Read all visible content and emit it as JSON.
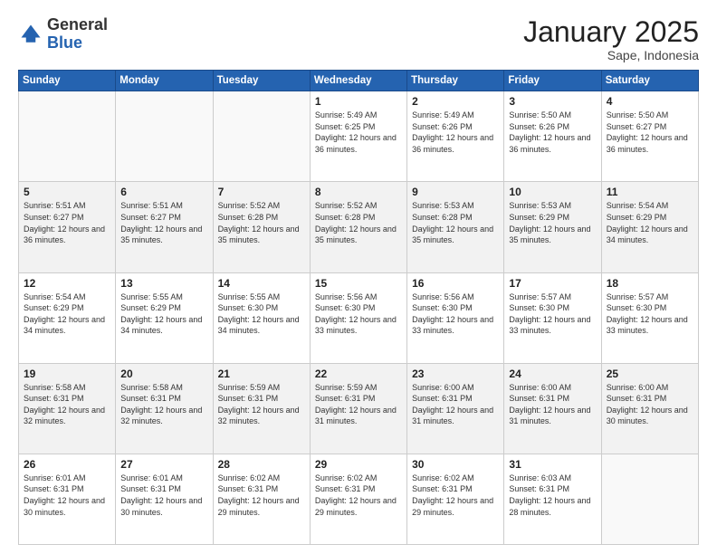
{
  "header": {
    "logo_general": "General",
    "logo_blue": "Blue",
    "title": "January 2025",
    "subtitle": "Sape, Indonesia"
  },
  "weekdays": [
    "Sunday",
    "Monday",
    "Tuesday",
    "Wednesday",
    "Thursday",
    "Friday",
    "Saturday"
  ],
  "weeks": [
    [
      {
        "day": "",
        "sunrise": "",
        "sunset": "",
        "daylight": ""
      },
      {
        "day": "",
        "sunrise": "",
        "sunset": "",
        "daylight": ""
      },
      {
        "day": "",
        "sunrise": "",
        "sunset": "",
        "daylight": ""
      },
      {
        "day": "1",
        "sunrise": "Sunrise: 5:49 AM",
        "sunset": "Sunset: 6:25 PM",
        "daylight": "Daylight: 12 hours and 36 minutes."
      },
      {
        "day": "2",
        "sunrise": "Sunrise: 5:49 AM",
        "sunset": "Sunset: 6:26 PM",
        "daylight": "Daylight: 12 hours and 36 minutes."
      },
      {
        "day": "3",
        "sunrise": "Sunrise: 5:50 AM",
        "sunset": "Sunset: 6:26 PM",
        "daylight": "Daylight: 12 hours and 36 minutes."
      },
      {
        "day": "4",
        "sunrise": "Sunrise: 5:50 AM",
        "sunset": "Sunset: 6:27 PM",
        "daylight": "Daylight: 12 hours and 36 minutes."
      }
    ],
    [
      {
        "day": "5",
        "sunrise": "Sunrise: 5:51 AM",
        "sunset": "Sunset: 6:27 PM",
        "daylight": "Daylight: 12 hours and 36 minutes."
      },
      {
        "day": "6",
        "sunrise": "Sunrise: 5:51 AM",
        "sunset": "Sunset: 6:27 PM",
        "daylight": "Daylight: 12 hours and 35 minutes."
      },
      {
        "day": "7",
        "sunrise": "Sunrise: 5:52 AM",
        "sunset": "Sunset: 6:28 PM",
        "daylight": "Daylight: 12 hours and 35 minutes."
      },
      {
        "day": "8",
        "sunrise": "Sunrise: 5:52 AM",
        "sunset": "Sunset: 6:28 PM",
        "daylight": "Daylight: 12 hours and 35 minutes."
      },
      {
        "day": "9",
        "sunrise": "Sunrise: 5:53 AM",
        "sunset": "Sunset: 6:28 PM",
        "daylight": "Daylight: 12 hours and 35 minutes."
      },
      {
        "day": "10",
        "sunrise": "Sunrise: 5:53 AM",
        "sunset": "Sunset: 6:29 PM",
        "daylight": "Daylight: 12 hours and 35 minutes."
      },
      {
        "day": "11",
        "sunrise": "Sunrise: 5:54 AM",
        "sunset": "Sunset: 6:29 PM",
        "daylight": "Daylight: 12 hours and 34 minutes."
      }
    ],
    [
      {
        "day": "12",
        "sunrise": "Sunrise: 5:54 AM",
        "sunset": "Sunset: 6:29 PM",
        "daylight": "Daylight: 12 hours and 34 minutes."
      },
      {
        "day": "13",
        "sunrise": "Sunrise: 5:55 AM",
        "sunset": "Sunset: 6:29 PM",
        "daylight": "Daylight: 12 hours and 34 minutes."
      },
      {
        "day": "14",
        "sunrise": "Sunrise: 5:55 AM",
        "sunset": "Sunset: 6:30 PM",
        "daylight": "Daylight: 12 hours and 34 minutes."
      },
      {
        "day": "15",
        "sunrise": "Sunrise: 5:56 AM",
        "sunset": "Sunset: 6:30 PM",
        "daylight": "Daylight: 12 hours and 33 minutes."
      },
      {
        "day": "16",
        "sunrise": "Sunrise: 5:56 AM",
        "sunset": "Sunset: 6:30 PM",
        "daylight": "Daylight: 12 hours and 33 minutes."
      },
      {
        "day": "17",
        "sunrise": "Sunrise: 5:57 AM",
        "sunset": "Sunset: 6:30 PM",
        "daylight": "Daylight: 12 hours and 33 minutes."
      },
      {
        "day": "18",
        "sunrise": "Sunrise: 5:57 AM",
        "sunset": "Sunset: 6:30 PM",
        "daylight": "Daylight: 12 hours and 33 minutes."
      }
    ],
    [
      {
        "day": "19",
        "sunrise": "Sunrise: 5:58 AM",
        "sunset": "Sunset: 6:31 PM",
        "daylight": "Daylight: 12 hours and 32 minutes."
      },
      {
        "day": "20",
        "sunrise": "Sunrise: 5:58 AM",
        "sunset": "Sunset: 6:31 PM",
        "daylight": "Daylight: 12 hours and 32 minutes."
      },
      {
        "day": "21",
        "sunrise": "Sunrise: 5:59 AM",
        "sunset": "Sunset: 6:31 PM",
        "daylight": "Daylight: 12 hours and 32 minutes."
      },
      {
        "day": "22",
        "sunrise": "Sunrise: 5:59 AM",
        "sunset": "Sunset: 6:31 PM",
        "daylight": "Daylight: 12 hours and 31 minutes."
      },
      {
        "day": "23",
        "sunrise": "Sunrise: 6:00 AM",
        "sunset": "Sunset: 6:31 PM",
        "daylight": "Daylight: 12 hours and 31 minutes."
      },
      {
        "day": "24",
        "sunrise": "Sunrise: 6:00 AM",
        "sunset": "Sunset: 6:31 PM",
        "daylight": "Daylight: 12 hours and 31 minutes."
      },
      {
        "day": "25",
        "sunrise": "Sunrise: 6:00 AM",
        "sunset": "Sunset: 6:31 PM",
        "daylight": "Daylight: 12 hours and 30 minutes."
      }
    ],
    [
      {
        "day": "26",
        "sunrise": "Sunrise: 6:01 AM",
        "sunset": "Sunset: 6:31 PM",
        "daylight": "Daylight: 12 hours and 30 minutes."
      },
      {
        "day": "27",
        "sunrise": "Sunrise: 6:01 AM",
        "sunset": "Sunset: 6:31 PM",
        "daylight": "Daylight: 12 hours and 30 minutes."
      },
      {
        "day": "28",
        "sunrise": "Sunrise: 6:02 AM",
        "sunset": "Sunset: 6:31 PM",
        "daylight": "Daylight: 12 hours and 29 minutes."
      },
      {
        "day": "29",
        "sunrise": "Sunrise: 6:02 AM",
        "sunset": "Sunset: 6:31 PM",
        "daylight": "Daylight: 12 hours and 29 minutes."
      },
      {
        "day": "30",
        "sunrise": "Sunrise: 6:02 AM",
        "sunset": "Sunset: 6:31 PM",
        "daylight": "Daylight: 12 hours and 29 minutes."
      },
      {
        "day": "31",
        "sunrise": "Sunrise: 6:03 AM",
        "sunset": "Sunset: 6:31 PM",
        "daylight": "Daylight: 12 hours and 28 minutes."
      },
      {
        "day": "",
        "sunrise": "",
        "sunset": "",
        "daylight": ""
      }
    ]
  ]
}
